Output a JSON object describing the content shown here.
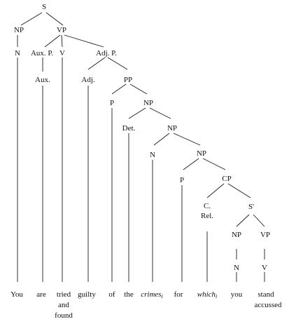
{
  "tree": {
    "nodes": {
      "s": "S",
      "np_subj": "NP",
      "vp_main": "VP",
      "n_subj": "N",
      "auxp": "Aux. P.",
      "aux": "Aux.",
      "v_main": "V",
      "adjp": "Adj. P.",
      "adj": "Adj.",
      "pp": "PP",
      "p_of": "P",
      "np_obj": "NP",
      "det": "Det.",
      "np_inner": "NP",
      "n_crimes": "N",
      "np_rel": "NP",
      "p_for": "P",
      "cp": "CP",
      "crel_1": "C.",
      "crel_2": "Rel.",
      "s_bar": "S'",
      "np_rel_subj": "NP",
      "vp_rel": "VP",
      "n_rel": "N",
      "v_rel": "V"
    },
    "words": {
      "you_subj": "You",
      "are": "are",
      "tried_1": "tried",
      "tried_2": "and",
      "tried_3": "found",
      "guilty": "guilty",
      "of": "of",
      "the": "the",
      "crimes": "crimes",
      "crimes_index": "i",
      "for": "for",
      "which": "which",
      "which_index": "i",
      "you_rel": "you",
      "stand": "stand",
      "accussed": "accussed"
    }
  }
}
